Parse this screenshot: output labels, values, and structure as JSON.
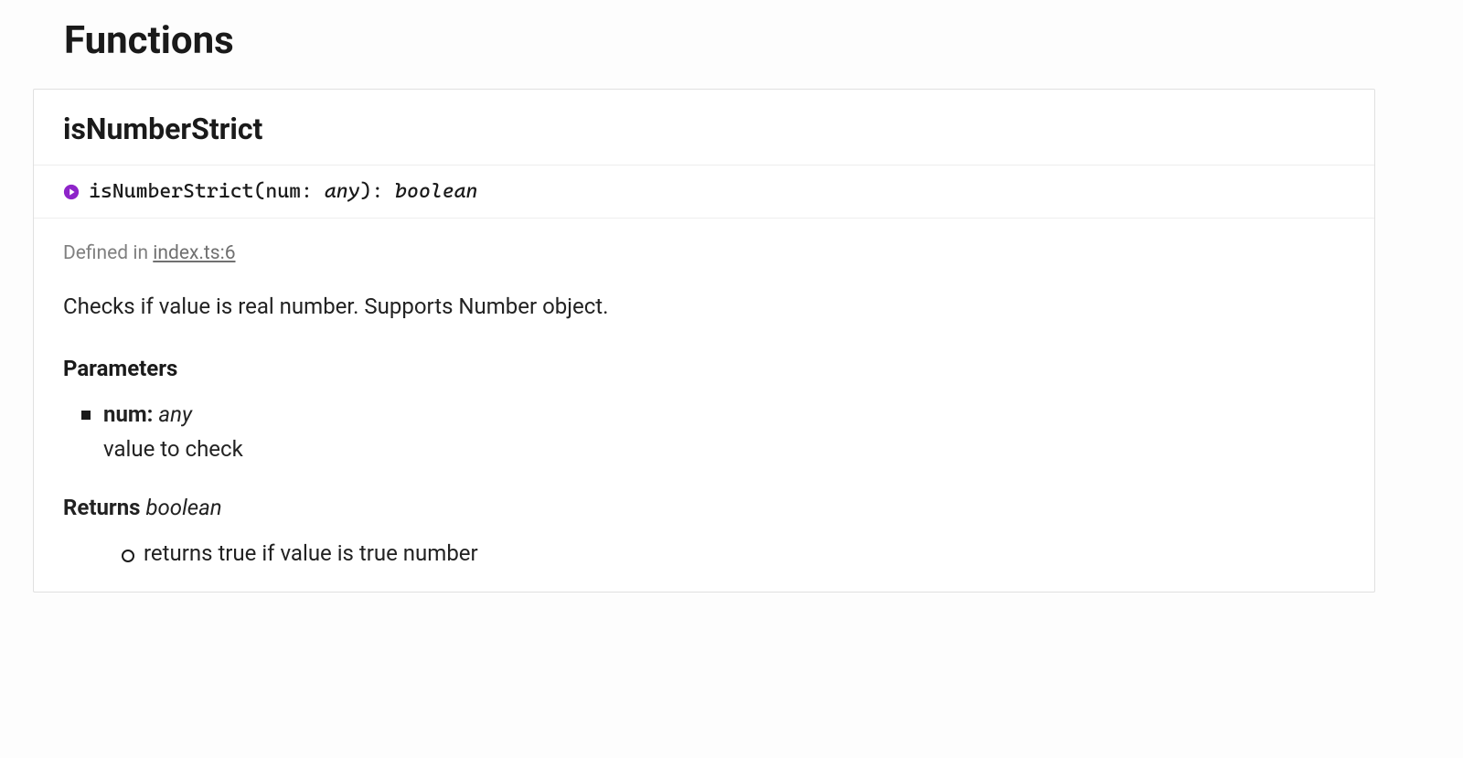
{
  "section_title": "Functions",
  "function": {
    "name": "isNumberStrict",
    "signature": {
      "fn": "isNumberStrict",
      "open": "(",
      "param": "num",
      "colon1": ": ",
      "param_type": "any",
      "close": ")",
      "colon2": ": ",
      "return_type": "boolean"
    },
    "defined_in_label": "Defined in ",
    "source_link": "index.ts:6",
    "description": "Checks if value is real number. Supports Number object.",
    "parameters_heading": "Parameters",
    "parameters": [
      {
        "name": "num: ",
        "type": "any",
        "desc": "value to check"
      }
    ],
    "returns_label": "Returns ",
    "returns_type": "boolean",
    "returns_items": [
      "returns true if value is true number"
    ]
  }
}
